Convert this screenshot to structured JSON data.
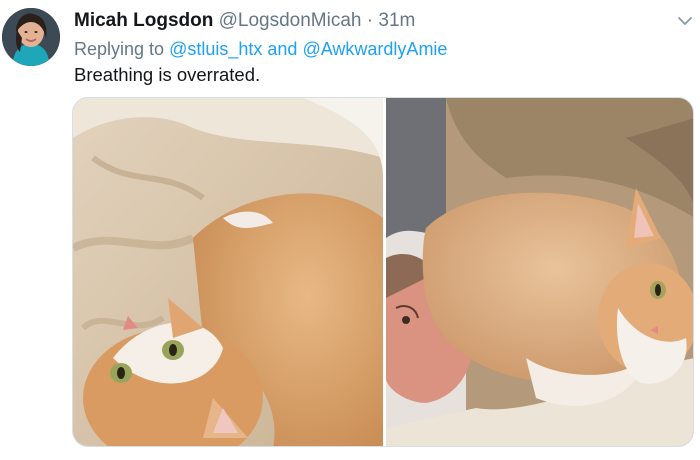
{
  "tweet": {
    "author_name": "Micah Logsdon",
    "author_handle": "@LogsdonMicah",
    "separator": "·",
    "time": "31m",
    "replying_prefix": "Replying to",
    "reply_mention_1": "@stluis_htx",
    "reply_conjunction": "and",
    "reply_mention_2": "@AwkwardlyAmie",
    "text": "Breathing is overrated.",
    "media_count": 2
  },
  "icons": {
    "menu": "chevron-down-icon",
    "avatar": "avatar"
  },
  "colors": {
    "link": "#1da1f2",
    "secondary_text": "#657786",
    "primary_text": "#14171a",
    "cat_fur": "#d9a36e",
    "blanket": "#d9c6ad"
  }
}
